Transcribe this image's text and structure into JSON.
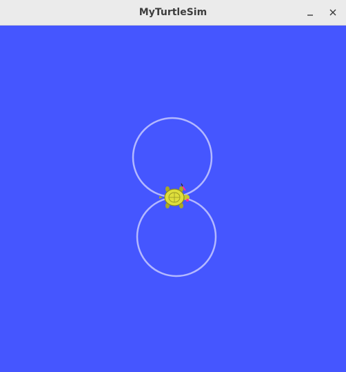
{
  "window": {
    "title": "MyTurtleSim",
    "minimize_icon": "minimize-icon",
    "close_icon": "close-icon"
  },
  "canvas": {
    "background_color": "#4556ff",
    "trail_color": "#b3b8ff",
    "trail_shape": "figure-eight"
  },
  "turtle": {
    "icon": "turtle-icon",
    "shell_color": "#dede3c",
    "pen_color": "#ff2aa0"
  }
}
